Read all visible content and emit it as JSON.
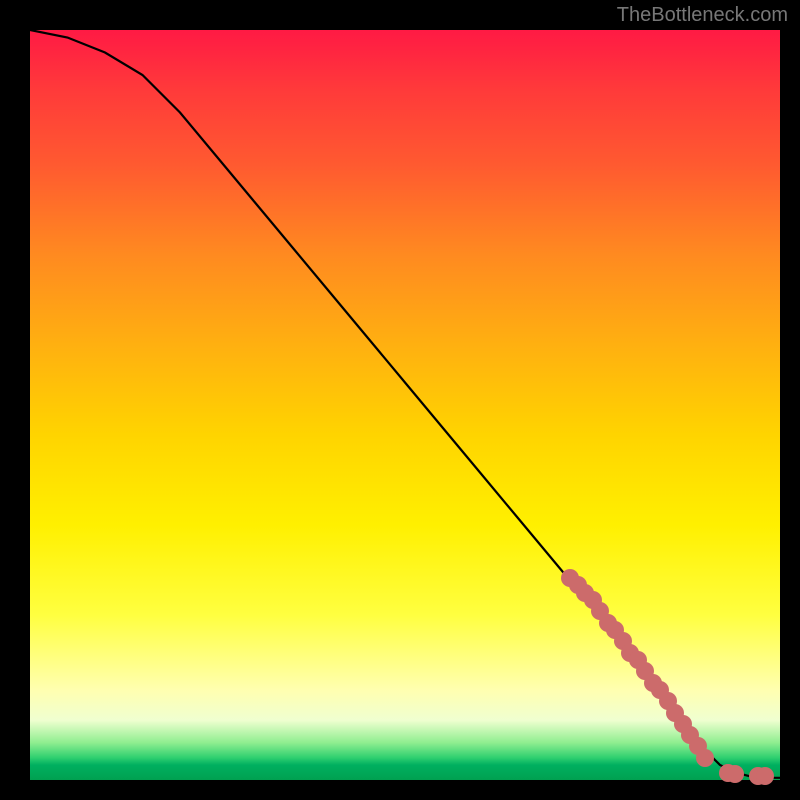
{
  "watermark": "TheBottleneck.com",
  "chart_data": {
    "type": "line",
    "title": "",
    "xlabel": "",
    "ylabel": "",
    "xlim": [
      0,
      100
    ],
    "ylim": [
      0,
      100
    ],
    "series": [
      {
        "name": "bottleneck-curve",
        "x": [
          0,
          5,
          10,
          15,
          20,
          25,
          30,
          35,
          40,
          45,
          50,
          55,
          60,
          65,
          70,
          75,
          80,
          85,
          88,
          90,
          92,
          94,
          96,
          98,
          100
        ],
        "y": [
          100,
          99,
          97,
          94,
          89,
          83,
          77,
          71,
          65,
          59,
          53,
          47,
          41,
          35,
          29,
          23,
          17,
          11,
          7,
          4,
          2,
          1,
          0.5,
          0.3,
          0.3
        ]
      }
    ],
    "scatter_points": {
      "name": "highlighted-cluster",
      "color": "#cc6b6b",
      "x": [
        72,
        73,
        74,
        75,
        76,
        77,
        78,
        79,
        80,
        81,
        82,
        83,
        84,
        85,
        86,
        87,
        88,
        89,
        90,
        93,
        94,
        97,
        98
      ],
      "y": [
        27,
        26,
        25,
        24,
        22.5,
        21,
        20,
        18.5,
        17,
        16,
        14.5,
        13,
        12,
        10.5,
        9,
        7.5,
        6,
        4.5,
        3,
        1,
        0.8,
        0.5,
        0.5
      ]
    },
    "background_gradient": {
      "top_color": "#ff1a44",
      "bottom_color": "#00a050",
      "description": "red-to-green vertical gradient"
    }
  }
}
